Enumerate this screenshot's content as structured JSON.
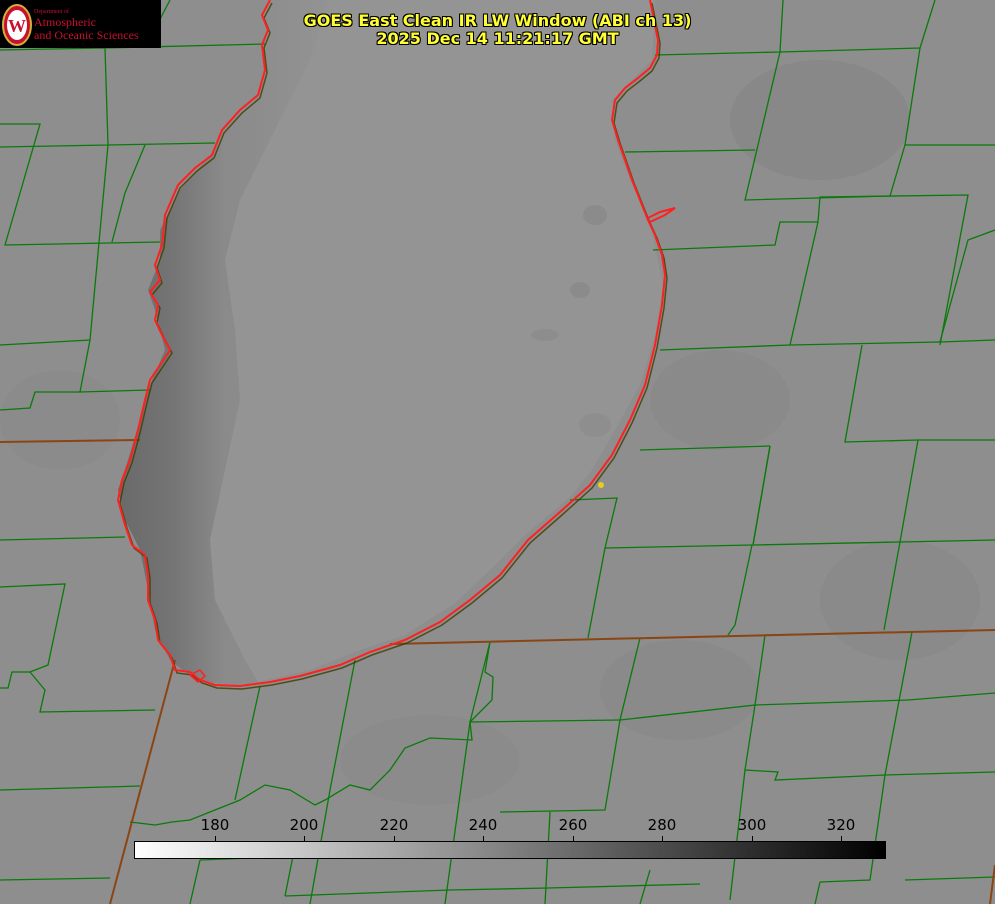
{
  "header": {
    "title": "GOES East Clean IR LW Window (ABI ch 13)",
    "timestamp": "2025 Dec 14 11:21:17 GMT"
  },
  "logo": {
    "line_small": "Department of",
    "line1": "Atmospheric",
    "line2": "and Oceanic Sciences",
    "crest_letter": "W"
  },
  "colorbar": {
    "ticks": [
      "180",
      "200",
      "220",
      "240",
      "260",
      "280",
      "300",
      "320"
    ],
    "min_color": "#ffffff",
    "max_color": "#000000"
  },
  "colors": {
    "background_land": "#8e8e8e",
    "lake_surface": "#939393",
    "shore_cold_band": "#6f6f6f",
    "county_lines": "#0a7a0a",
    "state_lines": "#8b4513",
    "lake_outline": "#ff2020",
    "station_marker": "#e0d020",
    "title_text": "#ffff33"
  }
}
